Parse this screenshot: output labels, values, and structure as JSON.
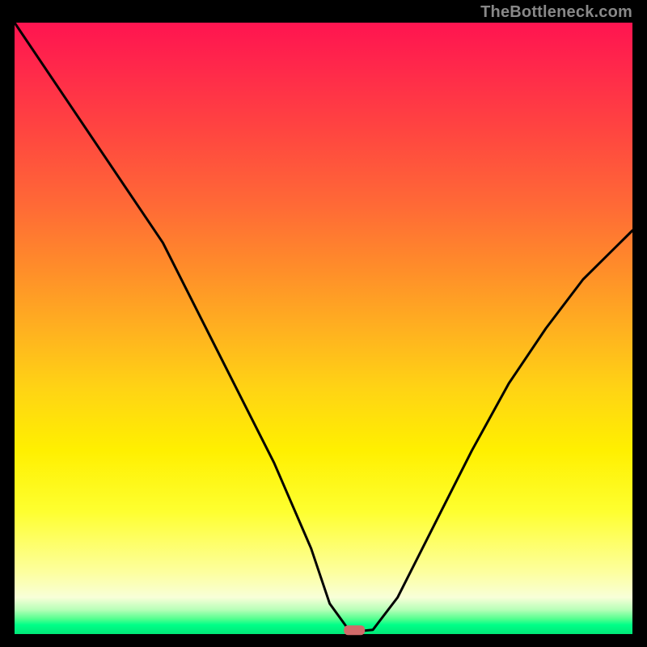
{
  "watermark": "TheBottleneck.com",
  "chart_data": {
    "type": "line",
    "title": "",
    "xlabel": "",
    "ylabel": "",
    "xlim": [
      0,
      100
    ],
    "ylim": [
      0,
      100
    ],
    "grid": false,
    "legend": false,
    "series": [
      {
        "name": "bottleneck-curve",
        "x": [
          0,
          6,
          12,
          18,
          24,
          30,
          36,
          42,
          48,
          51,
          54,
          55,
          56,
          58,
          62,
          68,
          74,
          80,
          86,
          92,
          100
        ],
        "values": [
          100,
          91,
          82,
          73,
          64,
          52,
          40,
          28,
          14,
          5,
          0.8,
          0.5,
          0.5,
          0.7,
          6,
          18,
          30,
          41,
          50,
          58,
          66
        ]
      }
    ],
    "marker": {
      "x": 55,
      "y": 0.5
    },
    "colors": {
      "curve": "#000000",
      "marker": "#d06a6a",
      "gradient_top": "#ff1450",
      "gradient_bottom": "#00e878"
    }
  }
}
